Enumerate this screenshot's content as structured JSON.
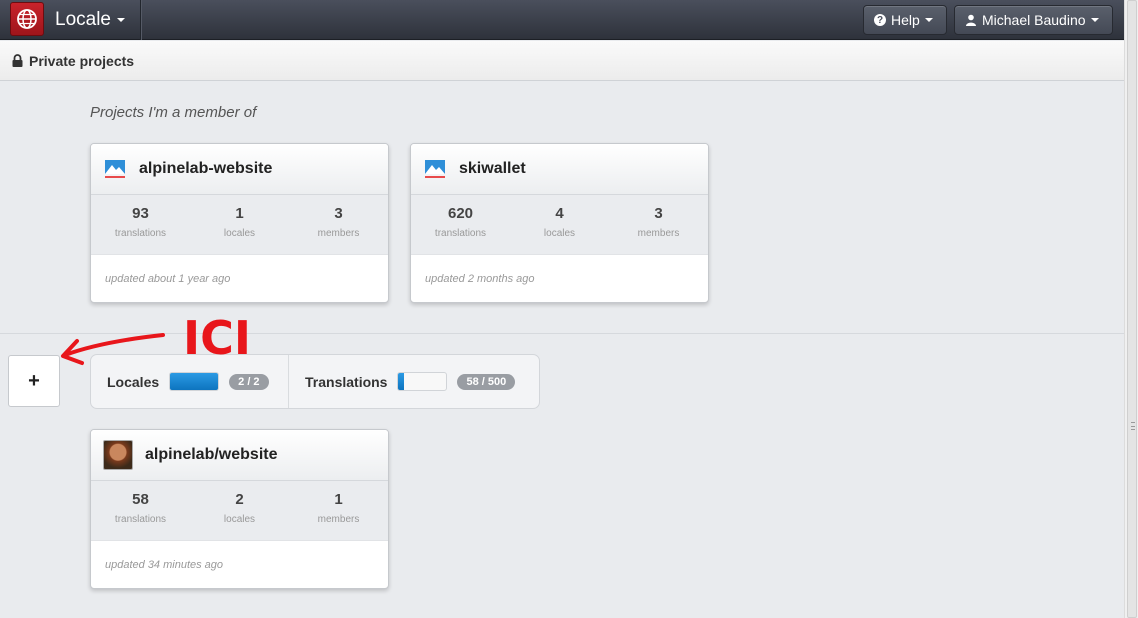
{
  "navbar": {
    "brand": "Locale",
    "help_label": "Help",
    "user_label": "Michael Baudino"
  },
  "subheader": {
    "title": "Private projects"
  },
  "section": {
    "title": "Projects I'm a member of"
  },
  "projects": [
    {
      "name": "alpinelab-website",
      "translations": "93",
      "locales": "1",
      "members": "3",
      "updated": "updated about 1 year ago"
    },
    {
      "name": "skiwallet",
      "translations": "620",
      "locales": "4",
      "members": "3",
      "updated": "updated 2 months ago"
    }
  ],
  "stat_labels": {
    "translations": "translations",
    "locales": "locales",
    "members": "members"
  },
  "usage": {
    "locales_label": "Locales",
    "locales_badge": "2 / 2",
    "locales_fill": 1.0,
    "translations_label": "Translations",
    "translations_badge": "58 / 500",
    "translations_fill": 0.116
  },
  "user_project": {
    "name": "alpinelab/website",
    "translations": "58",
    "locales": "2",
    "members": "1",
    "updated": "updated 34 minutes ago"
  },
  "annotation": {
    "text": "ICI",
    "color": "#e8161b"
  },
  "plus_label": "+",
  "colors": {
    "brand_red": "#c8232b",
    "meter_blue": "#0d74bf",
    "badge_gray": "#999da3"
  }
}
